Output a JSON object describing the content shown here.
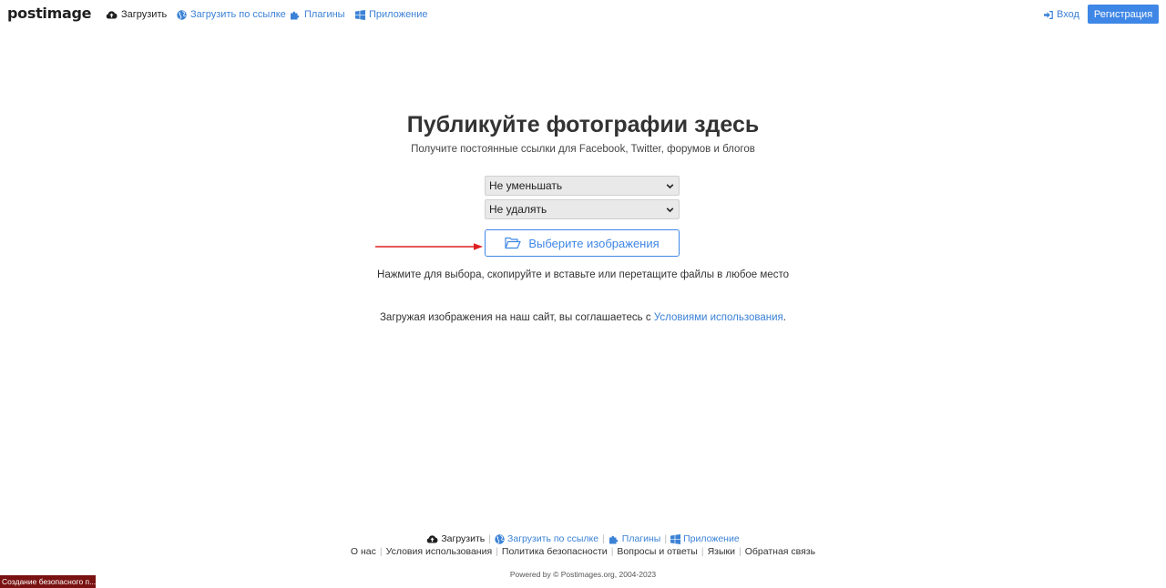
{
  "header": {
    "logo": "postimage",
    "nav": {
      "upload": "Загрузить",
      "upload_by_link": "Загрузить по ссылке",
      "plugins": "Плагины",
      "app": "Приложение"
    },
    "login": "Вход",
    "register": "Регистрация"
  },
  "main": {
    "title": "Публикуйте фотографии здесь",
    "subtitle": "Получите постоянные ссылки для Facebook, Twitter, форумов и блогов",
    "resize_select": "Не уменьшать",
    "expire_select": "Не удалять",
    "choose_button": "Выберите изображения",
    "hint": "Нажмите для выбора, скопируйте и вставьте или перетащите файлы в любое место",
    "terms_prefix": "Загружая изображения на наш сайт, вы соглашаетесь с ",
    "terms_link": "Условиями использования",
    "terms_suffix": "."
  },
  "footer": {
    "row1": {
      "upload": "Загрузить",
      "upload_by_link": "Загрузить по ссылке",
      "plugins": "Плагины",
      "app": "Приложение"
    },
    "row2": [
      "О нас",
      "Условия использования",
      "Политика безопасности",
      "Вопросы и ответы",
      "Языки",
      "Обратная связь"
    ],
    "powered": "Powered by © Postimages.org, 2004-2023"
  },
  "status_toast": "Создание безопасного п...",
  "colors": {
    "accent": "#3f87e6",
    "link": "#3b82d6",
    "arrow": "#e02020",
    "toast": "#7a1212"
  },
  "icons": {
    "upload": "cloud-upload-icon",
    "upload_by_link": "globe-icon",
    "plugins": "puzzle-icon",
    "app": "windows-icon",
    "login": "sign-in-icon",
    "choose": "folder-open-icon"
  }
}
